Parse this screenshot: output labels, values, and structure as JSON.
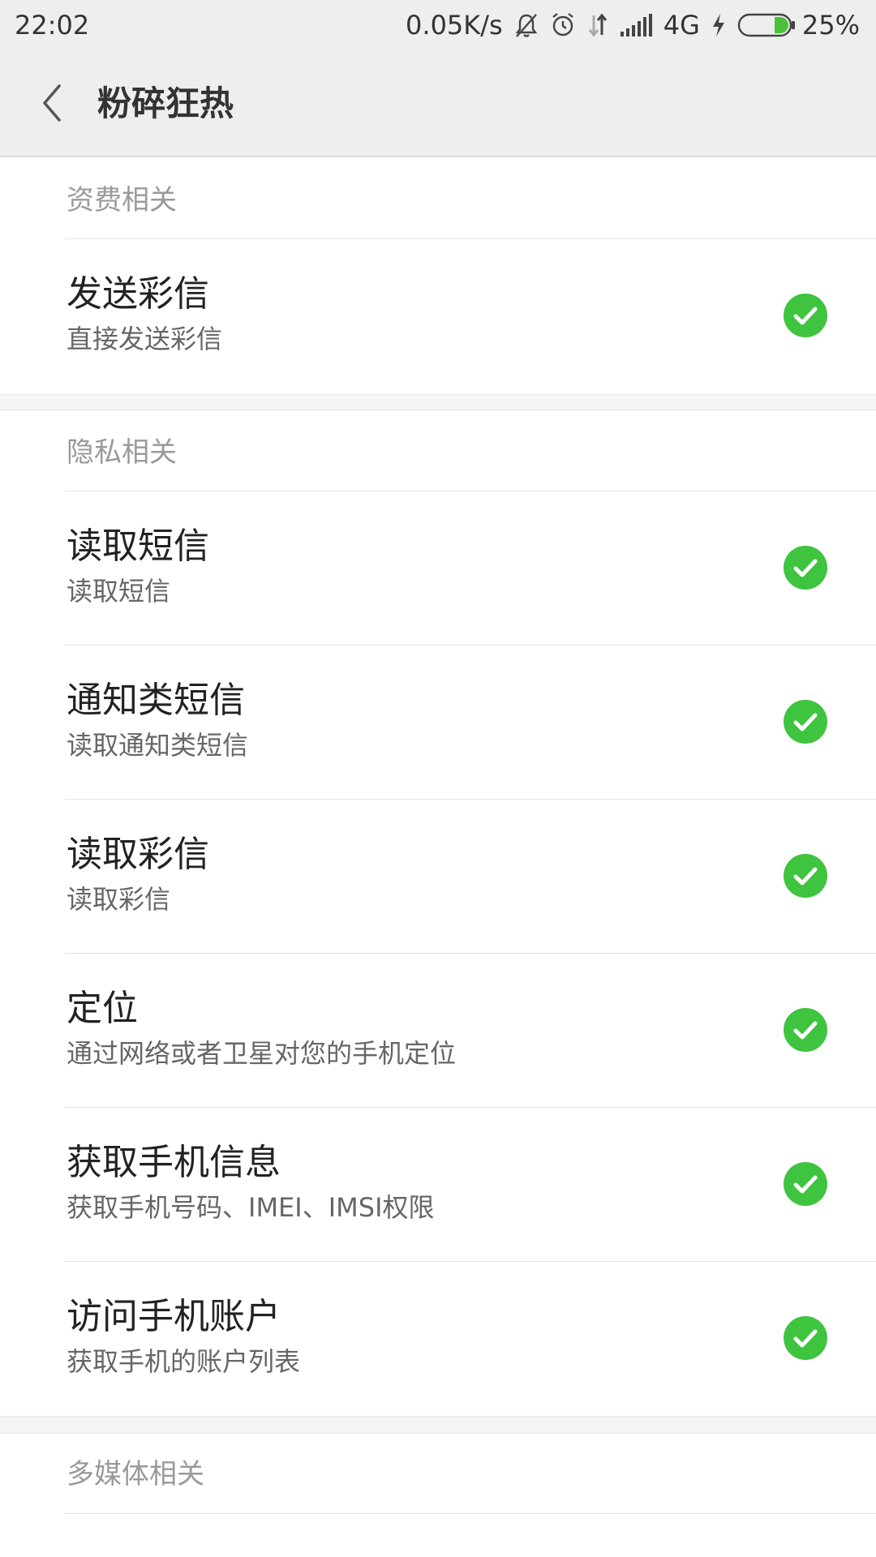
{
  "status_bar": {
    "time": "22:02",
    "net_speed": "0.05K/s",
    "network_type": "4G",
    "battery_percent": "25%",
    "battery_level": 0.25,
    "icons": [
      "mute-icon",
      "alarm-icon",
      "data-arrows-icon",
      "signal-icon",
      "charging-icon",
      "battery-icon"
    ]
  },
  "header": {
    "title": "粉碎狂热",
    "back_icon": "chevron-left-icon"
  },
  "accent_color": "#3ec43e",
  "sections": [
    {
      "header": "资费相关",
      "items": [
        {
          "title": "发送彩信",
          "desc": "直接发送彩信",
          "enabled": true
        }
      ]
    },
    {
      "header": "隐私相关",
      "items": [
        {
          "title": "读取短信",
          "desc": "读取短信",
          "enabled": true
        },
        {
          "title": "通知类短信",
          "desc": "读取通知类短信",
          "enabled": true
        },
        {
          "title": "读取彩信",
          "desc": "读取彩信",
          "enabled": true
        },
        {
          "title": "定位",
          "desc": "通过网络或者卫星对您的手机定位",
          "enabled": true
        },
        {
          "title": "获取手机信息",
          "desc": "获取手机号码、IMEI、IMSI权限",
          "enabled": true
        },
        {
          "title": "访问手机账户",
          "desc": "获取手机的账户列表",
          "enabled": true
        }
      ]
    },
    {
      "header": "多媒体相关",
      "items": []
    }
  ]
}
